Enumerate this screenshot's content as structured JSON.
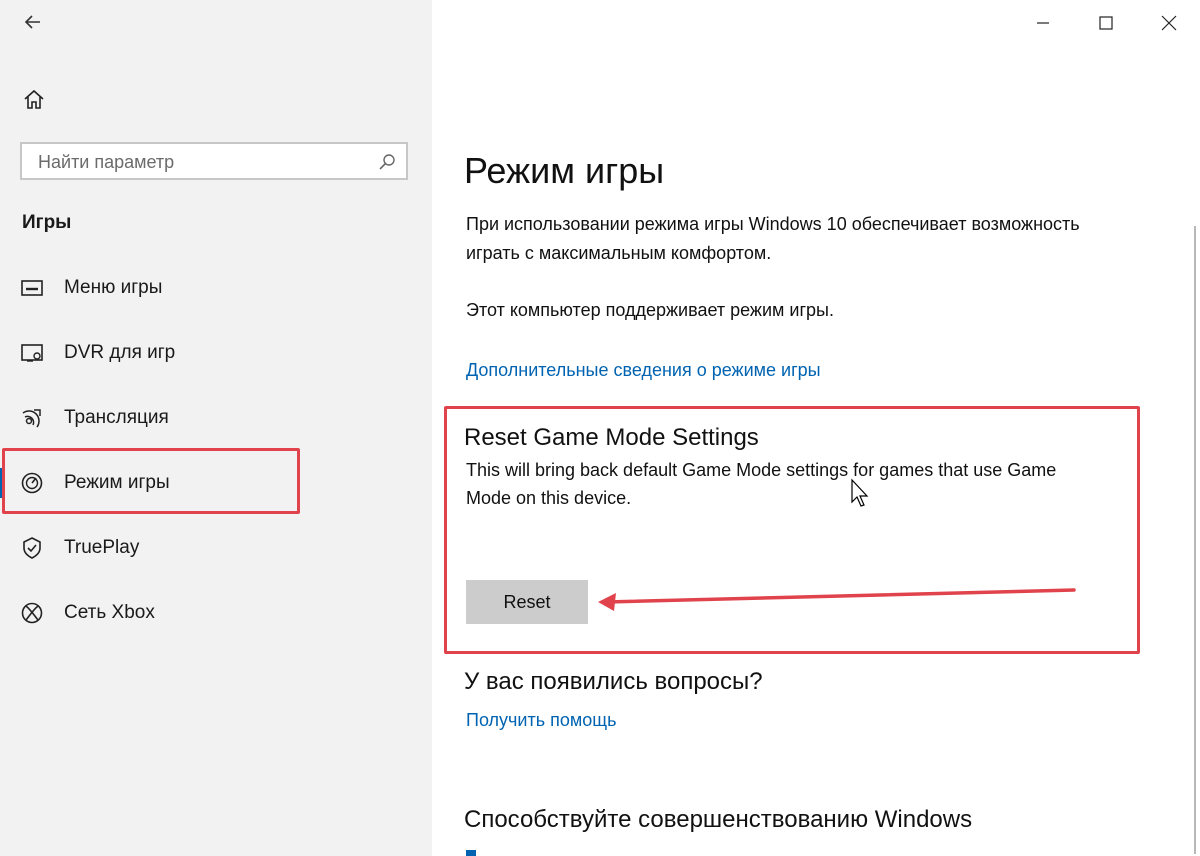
{
  "window": {
    "back_icon": "arrow-left-icon",
    "home_icon": "home-icon",
    "controls": [
      "minimize-icon",
      "maximize-icon",
      "close-icon"
    ]
  },
  "sidebar": {
    "search": {
      "placeholder": "Найти параметр",
      "icon": "search-icon"
    },
    "section_title": "Игры",
    "items": [
      {
        "label": "Меню игры",
        "icon": "game-bar-icon",
        "selected": false
      },
      {
        "label": "DVR для игр",
        "icon": "game-dvr-icon",
        "selected": false
      },
      {
        "label": "Трансляция",
        "icon": "broadcast-icon",
        "selected": false
      },
      {
        "label": "Режим игры",
        "icon": "game-mode-icon",
        "selected": true
      },
      {
        "label": "TruePlay",
        "icon": "trueplay-icon",
        "selected": false
      },
      {
        "label": "Сеть Xbox",
        "icon": "xbox-icon",
        "selected": false
      }
    ]
  },
  "main": {
    "title": "Режим игры",
    "description": "При использовании режима игры Windows 10 обеспечивает возможность играть с максимальным комфортом.",
    "supported_text": "Этот компьютер поддерживает режим игры.",
    "more_info_link": "Дополнительные сведения о режиме игры",
    "reset_section": {
      "title": "Reset Game Mode Settings",
      "description": "This will bring back default Game Mode settings for games that use Game Mode on this device.",
      "button_label": "Reset"
    },
    "questions_title": "У вас появились вопросы?",
    "help_link": "Получить помощь",
    "improve_title": "Способствуйте совершенствованию Windows"
  },
  "colors": {
    "accent": "#0063b1",
    "annotation": "#e0434b",
    "sidebar_bg": "#f2f2f2",
    "button_bg": "#cccccc"
  }
}
